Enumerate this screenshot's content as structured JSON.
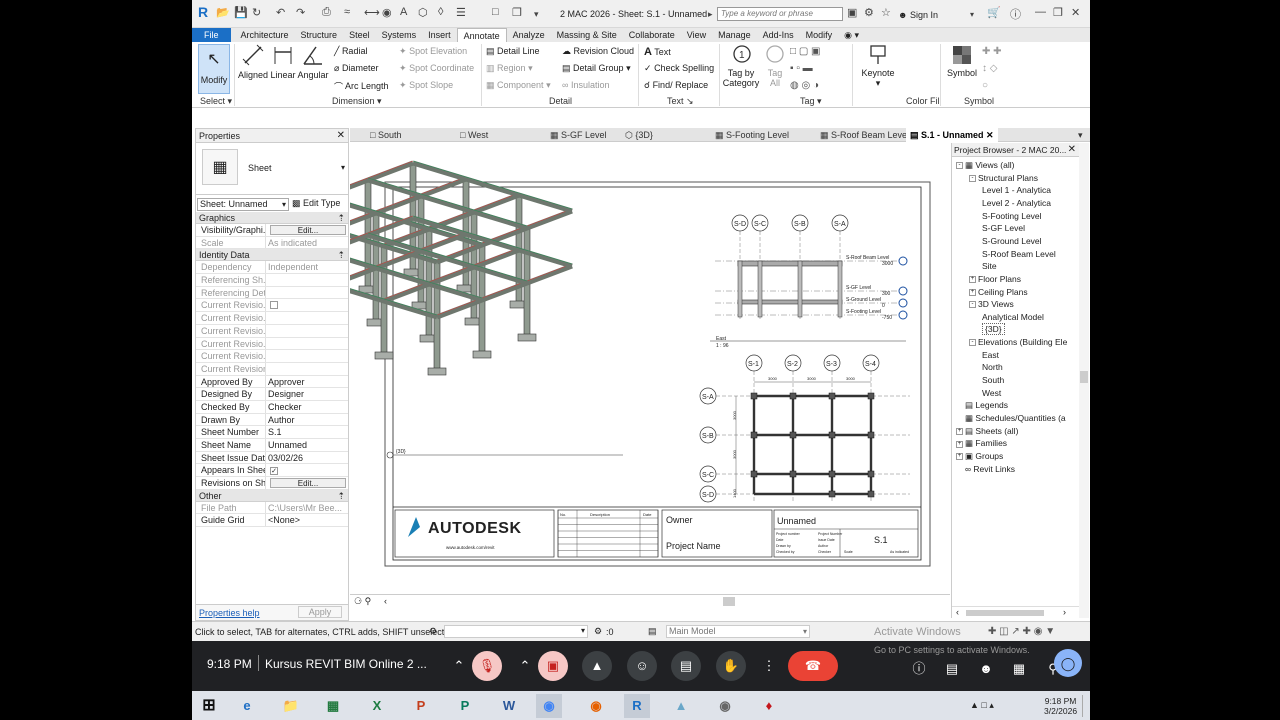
{
  "window": {
    "title": "2 MAC 2026 - Sheet: S.1 - Unnamed",
    "search_placeholder": "Type a keyword or phrase",
    "sign_in": "Sign In"
  },
  "ribbon_tabs": [
    "File",
    "Architecture",
    "Structure",
    "Steel",
    "Systems",
    "Insert",
    "Annotate",
    "Analyze",
    "Massing & Site",
    "Collaborate",
    "View",
    "Manage",
    "Add-Ins",
    "Modify"
  ],
  "active_ribbon_tab": "Annotate",
  "ribbon": {
    "modify": "Modify",
    "aligned": "Aligned",
    "linear": "Linear",
    "angular": "Angular",
    "radial": "Radial",
    "diameter": "Diameter",
    "arc_length": "Arc Length",
    "spot_elevation": "Spot Elevation",
    "spot_coordinate": "Spot Coordinate",
    "spot_slope": "Spot Slope",
    "detail_line": "Detail Line",
    "region": "Region",
    "component": "Component",
    "revision_cloud": "Revision Cloud",
    "detail_group": "Detail Group",
    "insulation": "Insulation",
    "text": "Text",
    "check_spelling": "Check Spelling",
    "find_replace": "Find/ Replace",
    "tag_by_category": "Tag by Category",
    "tag_all": "Tag All",
    "keynote": "Keynote",
    "symbol": "Symbol",
    "groups": {
      "select": "Select",
      "dimension": "Dimension",
      "detail": "Detail",
      "text": "Text",
      "tag": "Tag",
      "color_fill": "Color Fill",
      "symbol": "Symbol"
    }
  },
  "properties": {
    "title": "Properties",
    "type_name": "Sheet",
    "instance": "Sheet: Unnamed",
    "edit_type": "Edit Type",
    "edit_label": "Edit...",
    "sections": {
      "graphics": "Graphics",
      "identity": "Identity Data",
      "other": "Other"
    },
    "graphics": [
      {
        "k": "Visibility/Graphi...",
        "v": "Edit...",
        "btn": true
      },
      {
        "k": "Scale",
        "v": "As indicated",
        "dis": true
      }
    ],
    "identity": [
      {
        "k": "Dependency",
        "v": "Independent",
        "dis": true
      },
      {
        "k": "Referencing Sh...",
        "v": "",
        "dis": true
      },
      {
        "k": "Referencing Det...",
        "v": "",
        "dis": true
      },
      {
        "k": "Current Revisio...",
        "v": "",
        "dis": true,
        "chk": true
      },
      {
        "k": "Current Revisio...",
        "v": "",
        "dis": true
      },
      {
        "k": "Current Revisio...",
        "v": "",
        "dis": true
      },
      {
        "k": "Current Revisio...",
        "v": "",
        "dis": true
      },
      {
        "k": "Current Revisio...",
        "v": "",
        "dis": true
      },
      {
        "k": "Current Revision",
        "v": "",
        "dis": true
      },
      {
        "k": "Approved By",
        "v": "Approver"
      },
      {
        "k": "Designed By",
        "v": "Designer"
      },
      {
        "k": "Checked By",
        "v": "Checker"
      },
      {
        "k": "Drawn By",
        "v": "Author"
      },
      {
        "k": "Sheet Number",
        "v": "S.1"
      },
      {
        "k": "Sheet Name",
        "v": "Unnamed"
      },
      {
        "k": "Sheet Issue Date",
        "v": "03/02/26"
      },
      {
        "k": "Appears In Shee...",
        "v": "",
        "chkon": true
      },
      {
        "k": "Revisions on Sh...",
        "v": "Edit...",
        "btn": true
      }
    ],
    "other": [
      {
        "k": "File Path",
        "v": "C:\\Users\\Mr Bee...",
        "dis": true
      },
      {
        "k": "Guide Grid",
        "v": "<None>"
      }
    ],
    "help_link": "Properties help",
    "apply": "Apply"
  },
  "view_tabs": [
    "South",
    "West",
    "S-GF Level",
    "{3D}",
    "S-Footing Level",
    "S-Roof Beam Level",
    "S.1 - Unnamed"
  ],
  "sheet": {
    "logo": "AUTODESK",
    "logo_url": "www.autodesk.com/revit",
    "rev_headers": [
      "No.",
      "Description",
      "Date"
    ],
    "owner": "Owner",
    "project_name": "Project Name",
    "sheet_name": "Unnamed",
    "sheet_number": "S.1",
    "tb_labels": [
      "Project number",
      "Date",
      "Drawn by",
      "Checked by"
    ],
    "tb_values": [
      "Project Number",
      "Issue Date",
      "Author",
      "Checker"
    ],
    "tb_scale_label": "Scale",
    "tb_scale": "As indicated",
    "view_3d_label": "{3D}",
    "elev_label": "East",
    "elev_scale": "1 : 96",
    "grid_top": [
      "S-D",
      "S-C",
      "S-B",
      "S-A"
    ],
    "levels": [
      {
        "name": "S-Roof Beam Level",
        "elev": "3000"
      },
      {
        "name": "S-GF Level",
        "elev": "300"
      },
      {
        "name": "S-Ground Level",
        "elev": "0"
      },
      {
        "name": "S-Footing Level",
        "elev": "-750"
      }
    ],
    "plan_cols": [
      "S-1",
      "S-2",
      "S-3",
      "S-4"
    ],
    "plan_rows": [
      "S-A",
      "S-B",
      "S-C",
      "S-D"
    ],
    "dim_h": [
      "3000",
      "3000",
      "3000"
    ],
    "dim_v": [
      "3000",
      "3000",
      "1400"
    ]
  },
  "browser": {
    "title": "Project Browser - 2 MAC 20...",
    "items": [
      {
        "label": "Views (all)",
        "lvl": 0,
        "tw": "-",
        "icon": "views"
      },
      {
        "label": "Structural Plans",
        "lvl": 1,
        "tw": "-"
      },
      {
        "label": "Level 1 - Analytica",
        "lvl": 2
      },
      {
        "label": "Level 2 - Analytica",
        "lvl": 2
      },
      {
        "label": "S-Footing Level",
        "lvl": 2
      },
      {
        "label": "S-GF Level",
        "lvl": 2
      },
      {
        "label": "S-Ground Level",
        "lvl": 2
      },
      {
        "label": "S-Roof Beam Level",
        "lvl": 2
      },
      {
        "label": "Site",
        "lvl": 2
      },
      {
        "label": "Floor Plans",
        "lvl": 1,
        "tw": "+"
      },
      {
        "label": "Ceiling Plans",
        "lvl": 1,
        "tw": "+"
      },
      {
        "label": "3D Views",
        "lvl": 1,
        "tw": "-"
      },
      {
        "label": "Analytical Model",
        "lvl": 2
      },
      {
        "label": "{3D}",
        "lvl": 2,
        "sel": true
      },
      {
        "label": "Elevations (Building Ele",
        "lvl": 1,
        "tw": "-"
      },
      {
        "label": "East",
        "lvl": 2
      },
      {
        "label": "North",
        "lvl": 2
      },
      {
        "label": "South",
        "lvl": 2
      },
      {
        "label": "West",
        "lvl": 2
      },
      {
        "label": "Legends",
        "lvl": 0,
        "tw": "",
        "icon": "leg"
      },
      {
        "label": "Schedules/Quantities (a",
        "lvl": 0,
        "tw": "",
        "icon": "sch"
      },
      {
        "label": "Sheets (all)",
        "lvl": 0,
        "tw": "+",
        "icon": "sh"
      },
      {
        "label": "Families",
        "lvl": 0,
        "tw": "+",
        "icon": "fam"
      },
      {
        "label": "Groups",
        "lvl": 0,
        "tw": "+",
        "icon": "grp"
      },
      {
        "label": "Revit Links",
        "lvl": 0,
        "tw": "",
        "icon": "link"
      }
    ]
  },
  "status": {
    "hint": "Click to select, TAB for alternates, CTRL adds, SHIFT unselects",
    "count": ":0",
    "model": "Main Model"
  },
  "meet": {
    "time": "9:18 PM",
    "title": "Kursus REVIT BIM Online 2 ..."
  },
  "watermark": {
    "line1": "Activate Windows",
    "line2": "Go to PC settings to activate Windows."
  },
  "taskbar": {
    "time": "9:18 PM",
    "date": "3/2/2026"
  }
}
